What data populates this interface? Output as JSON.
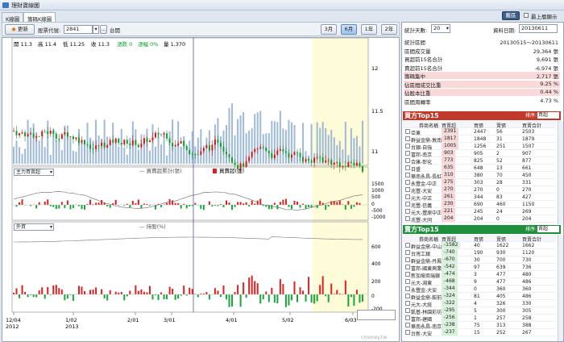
{
  "window": {
    "title": "理財寶線圖"
  },
  "tabs": [
    "K線圖",
    "籌碼K線圖"
  ],
  "toolbar": {
    "refresh": "更新",
    "stock_code_label": "股票代號:",
    "stock_code": "2841",
    "stock_name": "台開",
    "ranges": [
      "3月",
      "6月",
      "1年",
      "2年"
    ],
    "active_range": "6月"
  },
  "stats_controls": {
    "days_label": "統計天數:",
    "days": "20",
    "date_label": "資料日期:",
    "date": "20130611",
    "dock_btn": "戴區",
    "topmost_label": "最上層顯示"
  },
  "price_info": {
    "open": "開 11.3",
    "high": "高 11.4",
    "low": "低 11.25",
    "close": "收 11.3",
    "change": "漲跌 0",
    "pct": "漲幅 0%",
    "volume": "量 1,370"
  },
  "price_axis": [
    "12",
    "11.5",
    "11"
  ],
  "main_force": {
    "select": "主力買賣超",
    "legend_line": "買賣超累計(張)",
    "legend_bar": "買賣超(張)",
    "axis": [
      "1500",
      "1000",
      "500",
      "0",
      "-500",
      "-1000"
    ]
  },
  "foreign": {
    "select": "外資",
    "legend_line": "持股(%)",
    "axis": [
      "600",
      "400",
      "200",
      "0",
      "-200"
    ]
  },
  "x_axis": [
    {
      "l1": "12/04",
      "l2": "2012"
    },
    {
      "l1": "1/02",
      "l2": "2013"
    },
    {
      "l1": "2/01",
      "l2": ""
    },
    {
      "l1": "3/01",
      "l2": ""
    },
    {
      "l1": "4/01",
      "l2": ""
    },
    {
      "l1": "5/02",
      "l2": ""
    },
    {
      "l1": "6/03",
      "l2": ""
    }
  ],
  "stats": [
    {
      "k": "統計區間",
      "v": "20130515～20130611",
      "hl": false
    },
    {
      "k": "區間成交量",
      "v": "29,364 張",
      "hl": false
    },
    {
      "k": "買超前15名合計",
      "v": "9,691 張",
      "hl": false
    },
    {
      "k": "賣超前15名合計",
      "v": "-6,974 張",
      "hl": false
    },
    {
      "k": "籌碼集中",
      "v": "2,717 張",
      "hl": true
    },
    {
      "k": "佔區間成交比重",
      "v": "9.25 %",
      "hl": true
    },
    {
      "k": "佔股本比重",
      "v": "0.44 %",
      "hl": true
    },
    {
      "k": "區間周轉率",
      "v": "4.73 %",
      "hl": false
    }
  ],
  "buy_top": {
    "title": "買方Top15",
    "sort_label": "排序:",
    "sort": "買超",
    "cols": [
      "券商名稱",
      "買賣超",
      "買張",
      "賣張",
      "買賣合計"
    ],
    "rows": [
      [
        "亞東",
        "2391",
        "2447",
        "56",
        "2503"
      ],
      [
        "群益金鼎-敦南",
        "1817",
        "1848",
        "31",
        "1879"
      ],
      [
        "台銀-自強",
        "1005",
        "1256",
        "251",
        "1507"
      ],
      [
        "富邦-南京",
        "903",
        "905",
        "2",
        "907"
      ],
      [
        "合庫-彰化",
        "773",
        "825",
        "52",
        "877"
      ],
      [
        "日盛",
        "635",
        "648",
        "13",
        "661"
      ],
      [
        "華南永昌-長虹",
        "310",
        "380",
        "70",
        "450"
      ],
      [
        "永豐金-中正",
        "275",
        "303",
        "28",
        "331"
      ],
      [
        "兆豐-大安",
        "270",
        "270",
        "0",
        "270"
      ],
      [
        "元大-中正",
        "261",
        "344",
        "83",
        "427"
      ],
      [
        "兆豐-信義",
        "230",
        "690",
        "460",
        "1150"
      ],
      [
        "元大-豐原中正",
        "221",
        "245",
        "24",
        "269"
      ],
      [
        "兆豐-大同",
        "204",
        "204",
        "0",
        "204"
      ]
    ]
  },
  "sell_top": {
    "title": "賣方Top15",
    "sort_label": "排序:",
    "sort": "賣超",
    "cols": [
      "券商名稱",
      "買賣超",
      "買張",
      "賣張",
      "買賣合計"
    ],
    "rows": [
      [
        "群益金鼎-中山",
        "-1582",
        "40",
        "1622",
        "1662"
      ],
      [
        "台灣工銀",
        "-740",
        "190",
        "930",
        "1120"
      ],
      [
        "群益金鼎-丹鳳",
        "-670",
        "30",
        "700",
        "730"
      ],
      [
        "富邦-國東興業",
        "-542",
        "97",
        "639",
        "736"
      ],
      [
        "新加坡商瑞銀",
        "-474",
        "3",
        "477",
        "480"
      ],
      [
        "元大-淵東",
        "-468",
        "9",
        "477",
        "486"
      ],
      [
        "永豐金-大安",
        "-344",
        "0",
        "360",
        "360"
      ],
      [
        "群益金鼎-館前",
        "-324",
        "81",
        "405",
        "486"
      ],
      [
        "元大-大統",
        "-322",
        "4",
        "326",
        "330"
      ],
      [
        "凱基-林園彩坊",
        "-295",
        "5",
        "300",
        "305"
      ],
      [
        "富邦-建國",
        "-256",
        "1",
        "257",
        "258"
      ],
      [
        "華南永昌-南京",
        "-238",
        "75",
        "313",
        "388"
      ],
      [
        "台新-大安",
        "-237",
        "15",
        "252",
        "267"
      ]
    ]
  },
  "watermark": "cmoney.tw"
}
